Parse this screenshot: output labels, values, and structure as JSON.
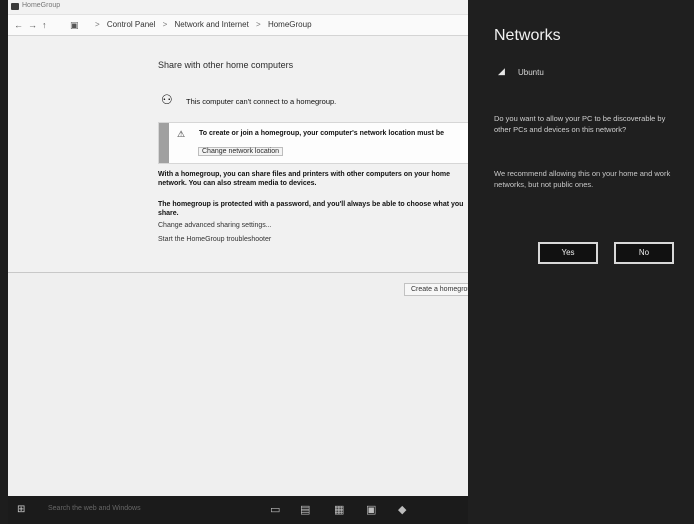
{
  "window": {
    "title": "HomeGroup",
    "nav": {
      "back": "←",
      "forward": "→",
      "up": "↑"
    },
    "breadcrumbs": [
      "Control Panel",
      "Network and Internet",
      "HomeGroup"
    ],
    "separator": ">",
    "heading": "Share with other home computers",
    "status_text": "This computer can't connect to a homegroup.",
    "notice": {
      "warning_glyph": "⚠",
      "message": "To create or join a homegroup, your computer's network location must be",
      "link": "Change network location"
    },
    "paragraphs": [
      "With a homegroup, you can share files and printers with other computers on your home network. You can also stream media to devices.",
      "The homegroup is protected with a password, and you'll always be able to choose what you share."
    ],
    "links": [
      "Change advanced sharing settings...",
      "Start the HomeGroup troubleshooter"
    ],
    "footer_button": "Create a homegroup"
  },
  "taskbar": {
    "search_placeholder": "Search the web and Windows",
    "icons": [
      "task-view-icon",
      "file-explorer-icon",
      "store-icon",
      "network-icon",
      "edge-icon"
    ]
  },
  "charm": {
    "title": "Networks",
    "network_name": "Ubuntu",
    "question": "Do you want to allow your PC to be discoverable by other PCs and devices on this network?",
    "note": "We recommend allowing this on your home and work networks, but not public ones.",
    "yes_label": "Yes",
    "no_label": "No"
  },
  "colors": {
    "charm_bg": "#1f1f1f",
    "window_bg": "#f1f1f1",
    "taskbar_bg": "#1b1b1b"
  }
}
